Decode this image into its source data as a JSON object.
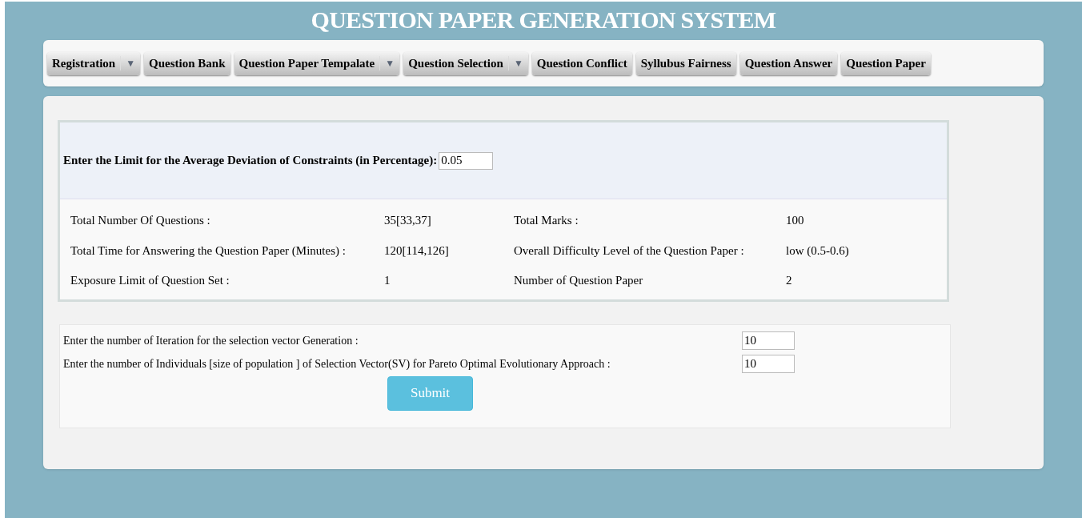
{
  "header": {
    "title": "QUESTION PAPER GENERATION SYSTEM"
  },
  "menu": [
    {
      "label": "Registration",
      "dropdown": true
    },
    {
      "label": "Question Bank",
      "dropdown": false
    },
    {
      "label": "Question Paper Tempalate",
      "dropdown": true
    },
    {
      "label": "Question Selection",
      "dropdown": true
    },
    {
      "label": "Question Conflict",
      "dropdown": false
    },
    {
      "label": "Syllubus Fairness",
      "dropdown": false
    },
    {
      "label": "Question Answer",
      "dropdown": false
    },
    {
      "label": "Question Paper",
      "dropdown": false
    }
  ],
  "dropdown_arrow": "▼",
  "deviation": {
    "label": "Enter the Limit for the Average Deviation of Constraints (in Percentage):",
    "value": "0.05"
  },
  "summary": [
    {
      "label": "Total Number Of Questions :",
      "value": "35[33,37]",
      "label_2": "Total Marks :",
      "value_2": "100"
    },
    {
      "label": "Total Time for Answering the Question Paper (Minutes) :",
      "value": "120[114,126]",
      "label_2": "Overall Difficulty Level of the Question Paper :",
      "value_2": "low (0.5-0.6)"
    },
    {
      "label": "Exposure Limit of Question Set :",
      "value": "1",
      "label_2": "Number of Question Paper",
      "value_2": "2"
    }
  ],
  "settings": [
    {
      "label": "Enter the number of Iteration for the selection vector Generation :",
      "value": "10"
    },
    {
      "label": "Enter the number of Individuals [size of population ] of Selection Vector(SV) for Pareto Optimal Evolutionary Approach :",
      "value": "10"
    }
  ],
  "submit": "Submit"
}
